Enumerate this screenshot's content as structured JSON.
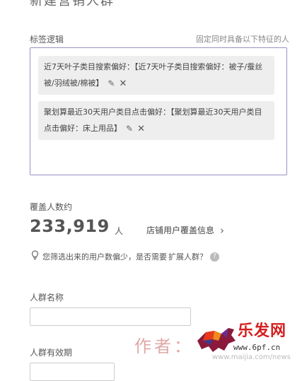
{
  "page": {
    "title": "新建营销人群"
  },
  "tag_logic": {
    "label": "标签逻辑",
    "hint": "固定同时具备以下特征的人",
    "tags": [
      {
        "text": "近7天叶子类目搜索偏好：【近7天叶子类目搜索偏好：被子/蚕丝被/羽绒被/棉被】",
        "edit_icon": "pencil-icon",
        "remove_icon": "close-icon"
      },
      {
        "text": "聚划算最近30天用户类目点击偏好：【聚划算最近30天用户类目点击偏好：床上用品】",
        "edit_icon": "pencil-icon",
        "remove_icon": "close-icon"
      }
    ]
  },
  "coverage": {
    "label": "覆盖人数约",
    "count": "233,919",
    "unit": "人",
    "store_link": "店铺用户覆盖信息",
    "tip": "您筛选出来的用户数偏少，是否需要",
    "expand_link": "扩展人群？"
  },
  "form": {
    "name_label": "人群名称",
    "name_value": "",
    "valid_label": "人群有效期"
  },
  "watermark": {
    "author": "作者：",
    "brand": "乐发网",
    "site": "www.6pf.cn",
    "url": "www.maijia.com/news"
  }
}
